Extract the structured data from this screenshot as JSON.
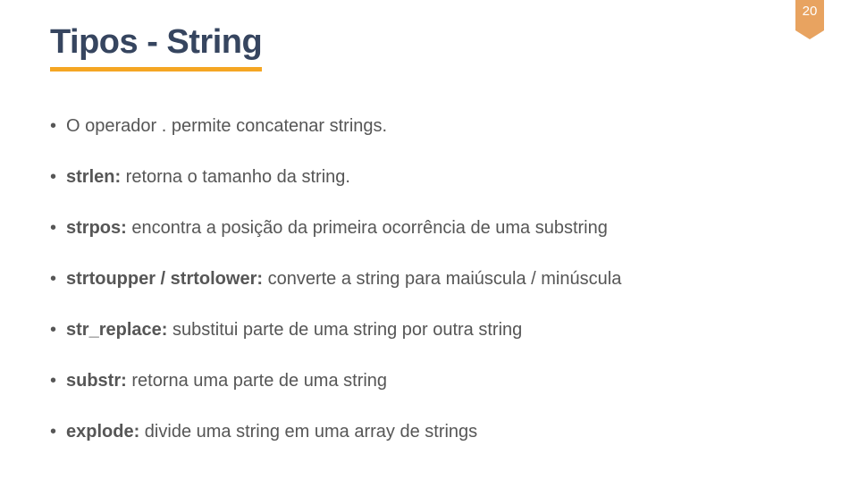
{
  "page_number": "20",
  "title": "Tipos - String",
  "bullets": [
    {
      "segments": [
        {
          "text": "O operador . permite concatenar strings.",
          "bold": false
        }
      ]
    },
    {
      "segments": [
        {
          "text": "strlen:",
          "bold": true
        },
        {
          "text": " retorna o tamanho da string.",
          "bold": false
        }
      ]
    },
    {
      "segments": [
        {
          "text": "strpos:",
          "bold": true
        },
        {
          "text": " encontra a posição da primeira ocorrência de uma substring",
          "bold": false
        }
      ]
    },
    {
      "segments": [
        {
          "text": "strtoupper / strtolower:",
          "bold": true
        },
        {
          "text": " converte a string para maiúscula / minúscula",
          "bold": false
        }
      ]
    },
    {
      "segments": [
        {
          "text": "str_replace:",
          "bold": true
        },
        {
          "text": " substitui parte de uma string por outra string",
          "bold": false
        }
      ]
    },
    {
      "segments": [
        {
          "text": "substr:",
          "bold": true
        },
        {
          "text": " retorna uma parte de uma string",
          "bold": false
        }
      ]
    },
    {
      "segments": [
        {
          "text": "explode:",
          "bold": true
        },
        {
          "text": " divide uma string em uma array de strings",
          "bold": false
        }
      ]
    }
  ]
}
